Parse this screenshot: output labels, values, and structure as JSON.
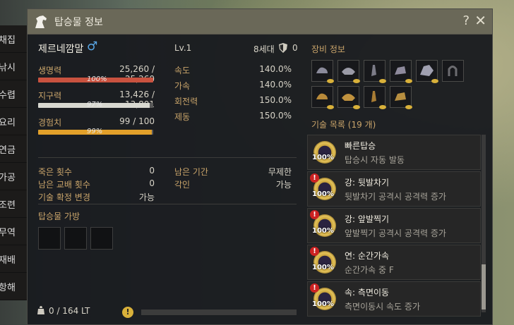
{
  "sidebar": {
    "items": [
      "채집",
      "낚시",
      "수렵",
      "요리",
      "연금",
      "가공",
      "조련",
      "무역",
      "재배",
      "항해"
    ]
  },
  "window": {
    "title": "탑승물 정보",
    "help": "?",
    "close": "✕"
  },
  "horse": {
    "name": "제르네깜말",
    "gender_icon": "♂",
    "level": "Lv.1",
    "generation": "8세대",
    "armor_value": "0"
  },
  "stats": {
    "hp": {
      "label": "생명력",
      "value": "25,260 / 25,260",
      "pct": "100%",
      "fraction": 1.0,
      "color": "#c9523f"
    },
    "stamina": {
      "label": "지구력",
      "value": "13,426 / 13,801",
      "pct": "97%",
      "fraction": 0.97,
      "color": "#d8d8d0"
    },
    "exp": {
      "label": "경험치",
      "value": "99 / 100",
      "pct": "99%",
      "fraction": 0.99,
      "color": "#e2a02a"
    }
  },
  "speed_stats": [
    {
      "label": "속도",
      "value": "140.0%"
    },
    {
      "label": "가속",
      "value": "140.0%"
    },
    {
      "label": "회전력",
      "value": "150.0%"
    },
    {
      "label": "제동",
      "value": "150.0%"
    }
  ],
  "info_left": [
    {
      "label": "죽은 횟수",
      "value": "0"
    },
    {
      "label": "남은 교배 횟수",
      "value": "0"
    },
    {
      "label": "기술 확정 변경",
      "value": "가능"
    }
  ],
  "info_right": [
    {
      "label": "남은 기간",
      "value": "무제한"
    },
    {
      "label": "각인",
      "value": "가능"
    }
  ],
  "bag": {
    "title": "탑승물 가방",
    "weight": "0 / 164 LT"
  },
  "equipment": {
    "title": "장비 정보"
  },
  "skills": {
    "title": "기술 목록 (19 개)",
    "items": [
      {
        "name": "빠른탑승",
        "desc": "탑승시 자동 발동",
        "pct": "100%",
        "warn": false
      },
      {
        "name": "강: 뒷발차기",
        "desc": "뒷발차기 공격시 공격력 증가",
        "pct": "100%",
        "warn": true
      },
      {
        "name": "강: 앞발찍기",
        "desc": "앞발찍기 공격시 공격력 증가",
        "pct": "100%",
        "warn": true
      },
      {
        "name": "연: 순간가속",
        "desc": "순간가속 중 F",
        "pct": "100%",
        "warn": true
      },
      {
        "name": "속: 측면이동",
        "desc": "측면이동시 속도 증가",
        "pct": "100%",
        "warn": true
      }
    ]
  }
}
